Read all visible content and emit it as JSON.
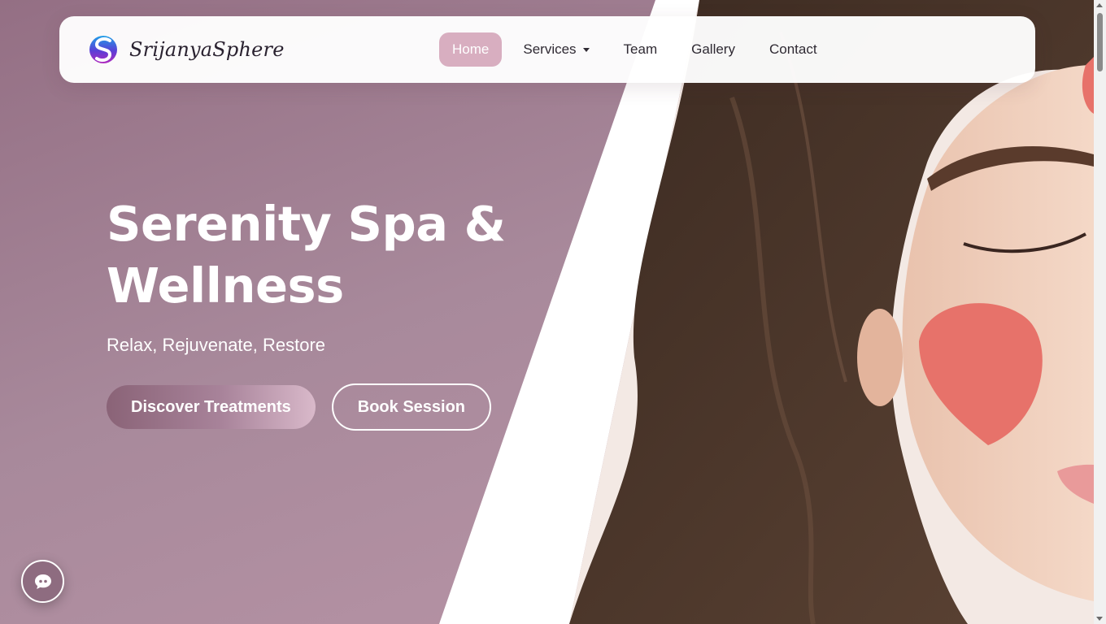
{
  "brand": {
    "name": "SrijanyaSphere",
    "logo_icon": "s-swirl-logo-icon"
  },
  "nav": {
    "items": [
      {
        "label": "Home",
        "active": true
      },
      {
        "label": "Services",
        "has_dropdown": true
      },
      {
        "label": "Team"
      },
      {
        "label": "Gallery"
      },
      {
        "label": "Contact"
      }
    ]
  },
  "hero": {
    "title_line1": "Serenity Spa &",
    "title_line2": "Wellness",
    "subtitle": "Relax, Rejuvenate, Restore",
    "primary_button": "Discover Treatments",
    "secondary_button": "Book Session"
  },
  "chat": {
    "icon": "chat-bubble-icon"
  },
  "colors": {
    "brand_mauve": "#946f84",
    "active_nav_pink": "#d8aec0",
    "text_dark": "#2f2a33"
  }
}
